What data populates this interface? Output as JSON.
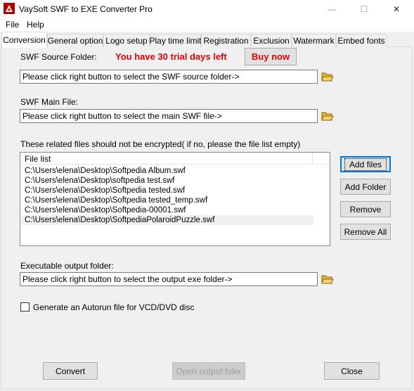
{
  "window": {
    "title": "VaySoft SWF to EXE Converter Pro",
    "min_glyph": "—",
    "max_glyph": "☐",
    "close_glyph": "✕"
  },
  "menu": [
    "File",
    "Help"
  ],
  "tabs": [
    "Conversion",
    "General option",
    "Logo setup",
    "Play time limit",
    "Registration",
    "Exclusion",
    "Watermark",
    "Embed fonts"
  ],
  "conversion": {
    "swf_source_label": "SWF Source Folder:",
    "trial_text": "You have 30 trial days left",
    "buy_label": "Buy now",
    "swf_source_value": "Please click right button to select the SWF source folder->",
    "swf_main_label": "SWF Main File:",
    "swf_main_value": "Please click right button to select the main SWF file->",
    "related_label": "These related files should not be encrypted( if no, please the file list empty)",
    "file_list_header": "File list",
    "files": [
      "C:\\Users\\elena\\Desktop\\Softpedia Album.swf",
      "C:\\Users\\elena\\Desktop\\softpedia test.swf",
      "C:\\Users\\elena\\Desktop\\Softpedia tested.swf",
      "C:\\Users\\elena\\Desktop\\Softpedia tested_temp.swf",
      "C:\\Users\\elena\\Desktop\\Softpedia-00001.swf",
      "C:\\Users\\elena\\Desktop\\SoftpediaPolaroidPuzzle.swf"
    ],
    "add_files_label": "Add files",
    "add_folder_label": "Add Folder",
    "remove_label": "Remove",
    "remove_all_label": "Remove All",
    "output_label": "Executable output folder:",
    "output_value": "Please click right button to select the output exe folder->",
    "autorun_label": "Generate an Autorun file for VCD/DVD disc",
    "autorun_checked": false
  },
  "footer": {
    "convert_label": "Convert",
    "open_output_label": "Open output foler",
    "close_label": "Close"
  },
  "colors": {
    "trial_red": "#e00000",
    "folder_yellow": "#e8b530"
  }
}
